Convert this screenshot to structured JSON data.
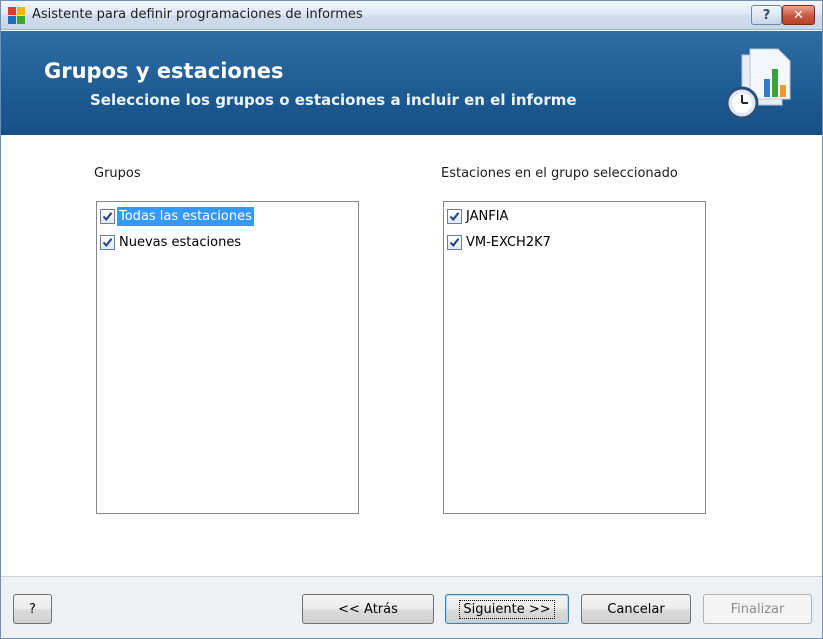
{
  "window": {
    "title": "Asistente para definir programaciones de informes",
    "help_label": "?",
    "close_label": "✕"
  },
  "banner": {
    "title": "Grupos y estaciones",
    "subtitle": "Seleccione los grupos o estaciones a incluir en el informe"
  },
  "groups": {
    "label": "Grupos",
    "items": [
      {
        "label": "Todas las estaciones",
        "checked": true,
        "selected": true
      },
      {
        "label": "Nuevas estaciones",
        "checked": true,
        "selected": false
      }
    ]
  },
  "stations": {
    "label": "Estaciones en el grupo seleccionado",
    "items": [
      {
        "label": "JANFIA",
        "checked": true
      },
      {
        "label": "VM-EXCH2K7",
        "checked": true
      }
    ]
  },
  "footer": {
    "help_label": "?",
    "back_label": "<< Atrás",
    "next_label": "Siguiente >>",
    "cancel_label": "Cancelar",
    "finish_label": "Finalizar"
  }
}
